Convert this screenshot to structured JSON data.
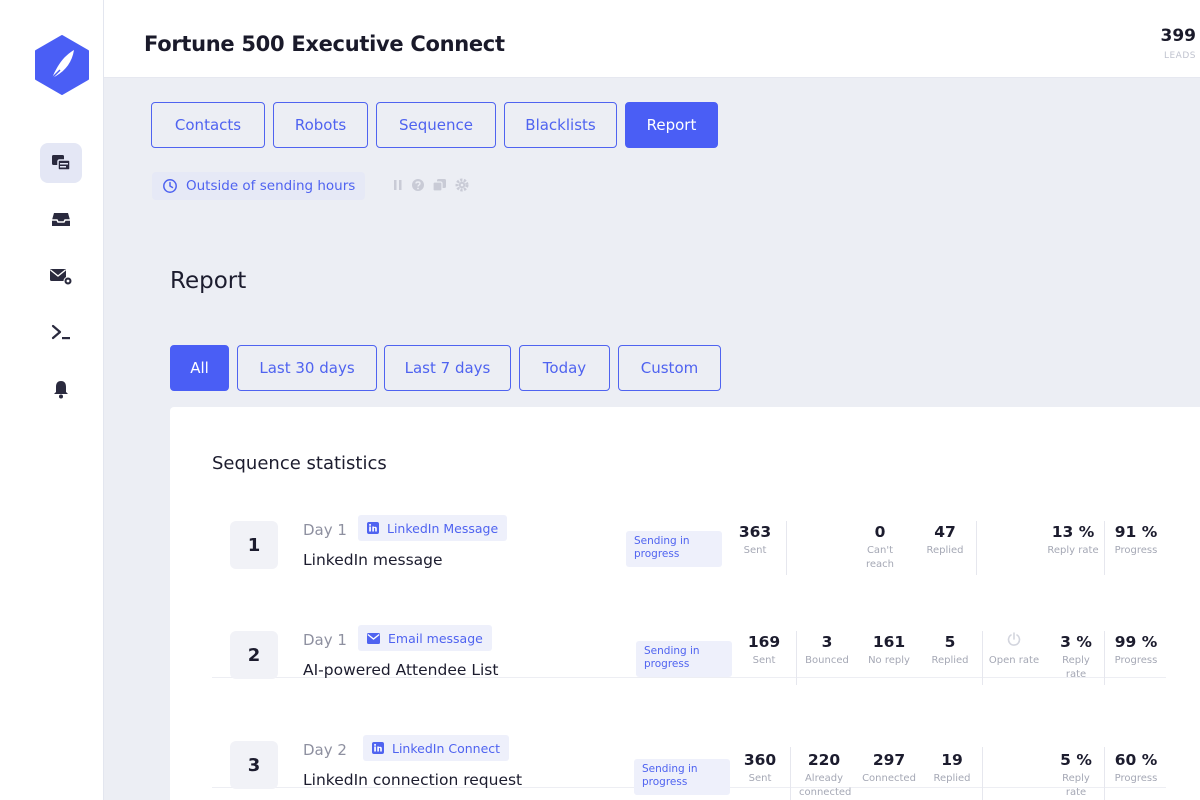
{
  "header": {
    "campaign_title": "Fortune 500 Executive Connect",
    "leads_count": "399",
    "leads_label": "LEADS"
  },
  "sidebar": {
    "items": [
      {
        "icon": "campaigns-icon",
        "active": true
      },
      {
        "icon": "inbox-icon",
        "active": false
      },
      {
        "icon": "email-settings-icon",
        "active": false
      },
      {
        "icon": "terminal-icon",
        "active": false
      },
      {
        "icon": "bell-icon",
        "active": false
      }
    ],
    "expand_label": "»"
  },
  "tabs": [
    {
      "label": "Contacts"
    },
    {
      "label": "Robots"
    },
    {
      "label": "Sequence"
    },
    {
      "label": "Blacklists"
    },
    {
      "label": "Report",
      "active": true
    }
  ],
  "sending_status": "Outside of sending hours",
  "report_title": "Report",
  "filters": [
    {
      "label": "All",
      "active": true
    },
    {
      "label": "Last 30 days"
    },
    {
      "label": "Last 7 days"
    },
    {
      "label": "Today"
    },
    {
      "label": "Custom"
    }
  ],
  "stats": {
    "title": "Sequence statistics",
    "rows": [
      {
        "number": "1",
        "day": "Day 1",
        "channel": "LinkedIn Message",
        "channel_icon": "linkedin-icon",
        "title": "LinkedIn message",
        "status": "Sending in progress",
        "sent": {
          "value": "363",
          "label": "Sent"
        },
        "cant_reach": {
          "value": "0",
          "label": "Can't reach"
        },
        "replied": {
          "value": "47",
          "label": "Replied"
        },
        "reply_rate": {
          "value": "13 %",
          "label": "Reply rate"
        },
        "progress": {
          "value": "91 %",
          "label": "Progress"
        }
      },
      {
        "number": "2",
        "day": "Day 1",
        "channel": "Email message",
        "channel_icon": "email-icon",
        "title": "AI-powered Attendee List",
        "status": "Sending in progress",
        "sent": {
          "value": "169",
          "label": "Sent"
        },
        "bounced": {
          "value": "3",
          "label": "Bounced"
        },
        "no_reply": {
          "value": "161",
          "label": "No reply"
        },
        "replied": {
          "value": "5",
          "label": "Replied"
        },
        "open_rate": {
          "label": "Open rate"
        },
        "reply_rate": {
          "value": "3 %",
          "label": "Reply rate"
        },
        "progress": {
          "value": "99 %",
          "label": "Progress"
        }
      },
      {
        "number": "3",
        "day": "Day 2",
        "channel": "LinkedIn Connect",
        "channel_icon": "linkedin-icon",
        "title": "LinkedIn connection request",
        "status": "Sending in progress",
        "sent": {
          "value": "360",
          "label": "Sent"
        },
        "already_connected": {
          "value": "220",
          "label": "Already connected"
        },
        "connected": {
          "value": "297",
          "label": "Connected"
        },
        "replied": {
          "value": "19",
          "label": "Replied"
        },
        "reply_rate": {
          "value": "5 %",
          "label": "Reply rate"
        },
        "progress": {
          "value": "60 %",
          "label": "Progress"
        }
      }
    ]
  },
  "colors": {
    "accent": "#4a5ef5",
    "background": "#eceef4",
    "text": "#1c1c2e"
  }
}
